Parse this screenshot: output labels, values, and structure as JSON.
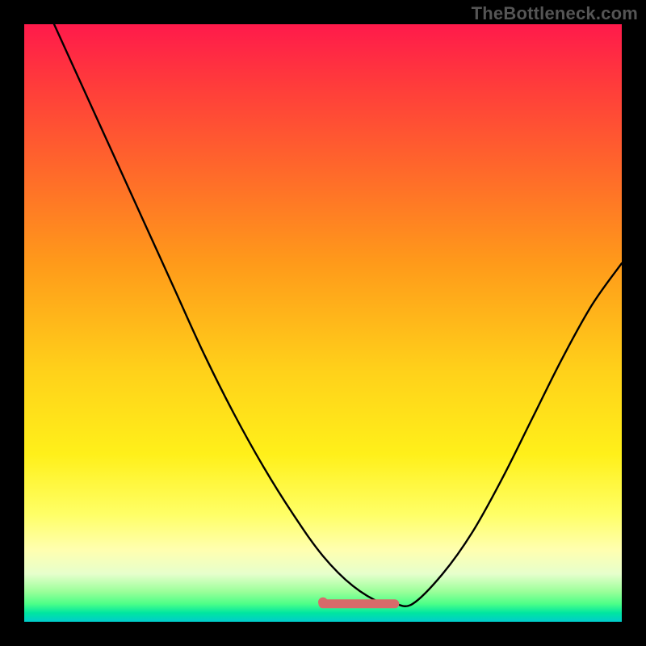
{
  "watermark": "TheBottleneck.com",
  "colors": {
    "background": "#000000",
    "curve": "#000000",
    "accent_segment": "#e57373",
    "gradient_top": "#ff1a4b",
    "gradient_mid": "#ffd11a",
    "gradient_bottom": "#00cccc"
  },
  "chart_data": {
    "type": "line",
    "title": "",
    "xlabel": "",
    "ylabel": "",
    "xlim": [
      0,
      100
    ],
    "ylim": [
      0,
      100
    ],
    "grid": false,
    "legend": false,
    "annotations": [],
    "series": [
      {
        "name": "bottleneck-curve",
        "x": [
          5,
          10,
          15,
          20,
          25,
          30,
          35,
          40,
          45,
          50,
          55,
          60,
          62,
          65,
          70,
          75,
          80,
          85,
          90,
          95,
          100
        ],
        "values": [
          100,
          89,
          78,
          67,
          56,
          45,
          35,
          26,
          18,
          11,
          6,
          3,
          3,
          3,
          8,
          15,
          24,
          34,
          44,
          53,
          60
        ]
      },
      {
        "name": "accent-flat-segment",
        "x": [
          50,
          55,
          60,
          62
        ],
        "values": [
          3,
          3,
          3,
          3
        ]
      }
    ]
  }
}
